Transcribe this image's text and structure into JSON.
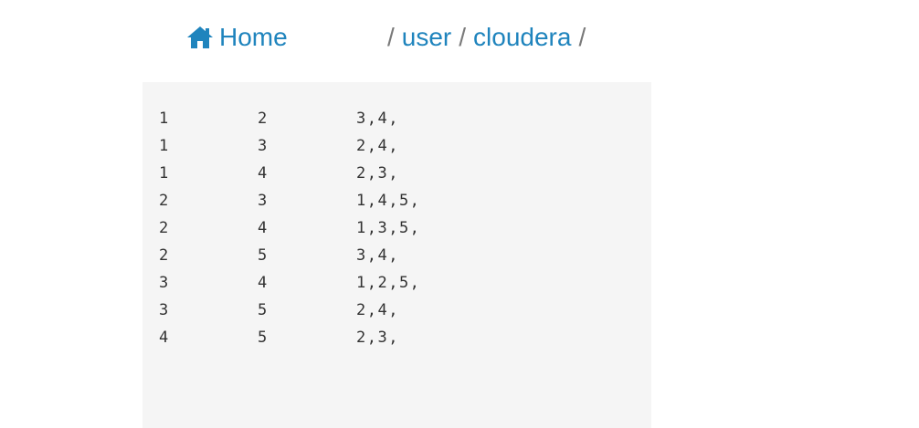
{
  "breadcrumb": {
    "home_label": "Home",
    "separator": "/",
    "segments": [
      "user",
      "cloudera"
    ]
  },
  "file": {
    "rows": [
      [
        "1",
        "2",
        "3,4,"
      ],
      [
        "1",
        "3",
        "2,4,"
      ],
      [
        "1",
        "4",
        "2,3,"
      ],
      [
        "2",
        "3",
        "1,4,5,"
      ],
      [
        "2",
        "4",
        "1,3,5,"
      ],
      [
        "2",
        "5",
        "3,4,"
      ],
      [
        "3",
        "4",
        "1,2,5,"
      ],
      [
        "3",
        "5",
        "2,4,"
      ],
      [
        "4",
        "5",
        "2,3,"
      ]
    ]
  },
  "colors": {
    "link": "#1f84bd",
    "separator": "#7a7a7a",
    "panel_bg": "#f5f5f5",
    "text": "#333333"
  },
  "icons": {
    "home": "home-icon"
  }
}
